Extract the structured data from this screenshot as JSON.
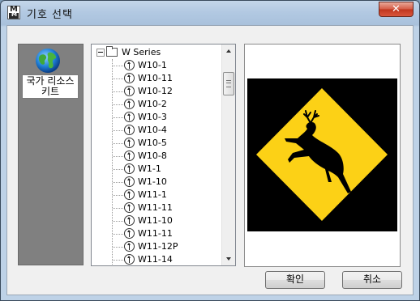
{
  "window": {
    "title": "기호 선택",
    "close_label": "✕",
    "app_icon_label": "MM"
  },
  "category": {
    "label_line1": "국가 리소스",
    "label_line2": "키트"
  },
  "tree": {
    "root_label": "W Series",
    "items": [
      "W10-1",
      "W10-11",
      "W10-12",
      "W10-2",
      "W10-3",
      "W10-4",
      "W10-5",
      "W10-8",
      "W1-1",
      "W1-10",
      "W11-1",
      "W11-11",
      "W11-10",
      "W11-11",
      "W11-12P",
      "W11-14"
    ]
  },
  "preview": {
    "sign_fill": "#fcd116",
    "sign_border": "#000000",
    "background": "#000000"
  },
  "buttons": {
    "ok_label": "확인",
    "cancel_label": "취소"
  },
  "colors": {
    "title_bar": "#b2c9e2",
    "panel_gray": "#808080",
    "close_red": "#c0351e"
  }
}
